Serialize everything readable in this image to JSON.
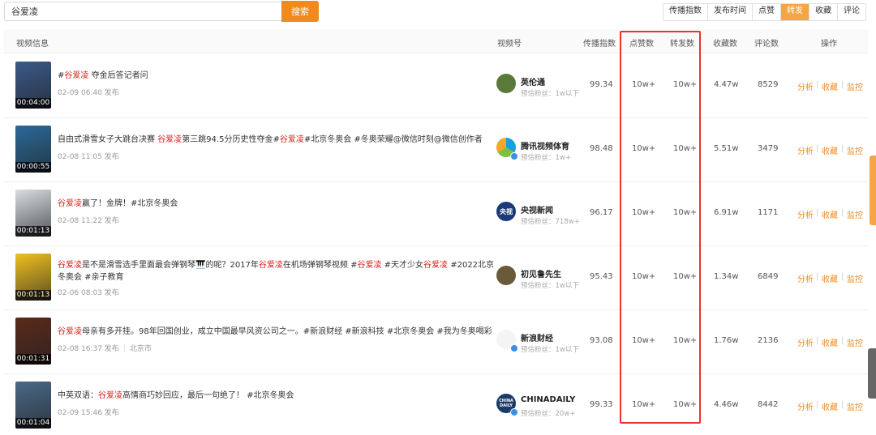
{
  "search": {
    "value": "谷爱凌",
    "button": "搜索"
  },
  "sort_tabs": [
    {
      "label": "传播指数",
      "active": false
    },
    {
      "label": "发布时间",
      "active": false
    },
    {
      "label": "点赞",
      "active": false
    },
    {
      "label": "转发",
      "active": true
    },
    {
      "label": "收藏",
      "active": false
    },
    {
      "label": "评论",
      "active": false
    }
  ],
  "columns": {
    "video_info": "视频信息",
    "channel": "视频号",
    "spread_index": "传播指数",
    "likes": "点赞数",
    "shares": "转发数",
    "favorites": "收藏数",
    "comments": "评论数",
    "actions": "操作"
  },
  "actions": {
    "analyze": "分析",
    "favorite": "收藏",
    "monitor": "监控",
    "separator": "|"
  },
  "rows": [
    {
      "title_parts": [
        "#",
        "谷爱凌",
        " 夺金后答记者问"
      ],
      "meta": "02-09 06:40 发布",
      "duration": "00:04:00",
      "account": "英伦通",
      "fans": "预估粉丝：1w以下",
      "spread": "99.34",
      "likes": "10w+",
      "shares": "10w+",
      "favorites": "4.47w",
      "comments": "8529",
      "thumb_color": "#3a5a8a",
      "avatar_color": "#5a7a3a"
    },
    {
      "title_parts": [
        "自由式滑雪女子大跳台决赛 ",
        "谷爱凌",
        "第三跳94.5分历史性夺金#",
        "谷爱凌",
        "#北京冬奥会 #冬奥荣耀@微信时刻@微信创作者"
      ],
      "meta": "02-08 11:05 发布",
      "duration": "00:00:55",
      "account": "腾讯视频体育",
      "fans": "预估粉丝：1w+",
      "spread": "98.48",
      "likes": "10w+",
      "shares": "10w+",
      "favorites": "5.51w",
      "comments": "3479",
      "thumb_color": "#2a6a9a",
      "avatar_color": "#1aa0e0"
    },
    {
      "title_parts": [
        "",
        "谷爱凌",
        "赢了！金牌！#北京冬奥会"
      ],
      "meta": "02-08 11:22 发布",
      "duration": "00:01:13",
      "account": "央视新闻",
      "fans": "预估粉丝：718w+",
      "spread": "96.17",
      "likes": "10w+",
      "shares": "10w+",
      "favorites": "6.91w",
      "comments": "1171",
      "thumb_color": "#d8dde2",
      "avatar_color": "#1a3a7a"
    },
    {
      "title_parts": [
        "",
        "谷爱凌",
        "是不是滑雪选手里面最会弹钢琴🎹的呢？2017年",
        "谷爱凌",
        "在机场弹钢琴视频 #",
        "谷爱凌",
        " #天才少女",
        "谷爱凌",
        " #2022北京冬奥会 #亲子教育"
      ],
      "meta": "02-06 08:03 发布",
      "duration": "00:01:13",
      "account": "初见鲁先生",
      "fans": "预估粉丝：1w以下",
      "spread": "95.43",
      "likes": "10w+",
      "shares": "10w+",
      "favorites": "1.34w",
      "comments": "6849",
      "thumb_color": "#f0c020",
      "avatar_color": "#6a5a3a"
    },
    {
      "title_parts": [
        "",
        "谷爱凌",
        "母亲有多开挂。98年回国创业，成立中国最早风资公司之一。#新浪财经 #新浪科技 #北京冬奥会 #我为冬奥喝彩"
      ],
      "meta": "02-08 16:37 发布",
      "meta_location": "北京市",
      "duration": "00:01:31",
      "account": "新浪财经",
      "fans": "预估粉丝：1w以下",
      "spread": "93.08",
      "likes": "10w+",
      "shares": "10w+",
      "favorites": "1.76w",
      "comments": "2136",
      "thumb_color": "#5a2a1a",
      "avatar_color": "#f4f4f4"
    },
    {
      "title_parts": [
        "中英双语：",
        "谷爱凌",
        "高情商巧妙回应，最后一句绝了！ #北京冬奥会"
      ],
      "meta": "02-09 15:46 发布",
      "duration": "00:01:04",
      "account": "CHINADAILY",
      "fans": "预估粉丝：20w+",
      "spread": "99.33",
      "likes": "10w+",
      "shares": "10w+",
      "favorites": "4.46w",
      "comments": "8442",
      "thumb_color": "#4a6a8a",
      "avatar_color": "#1a3a6a"
    }
  ],
  "avatar_labels": {
    "cctv": "央视",
    "chinadaily": "CHINA DAILY"
  }
}
